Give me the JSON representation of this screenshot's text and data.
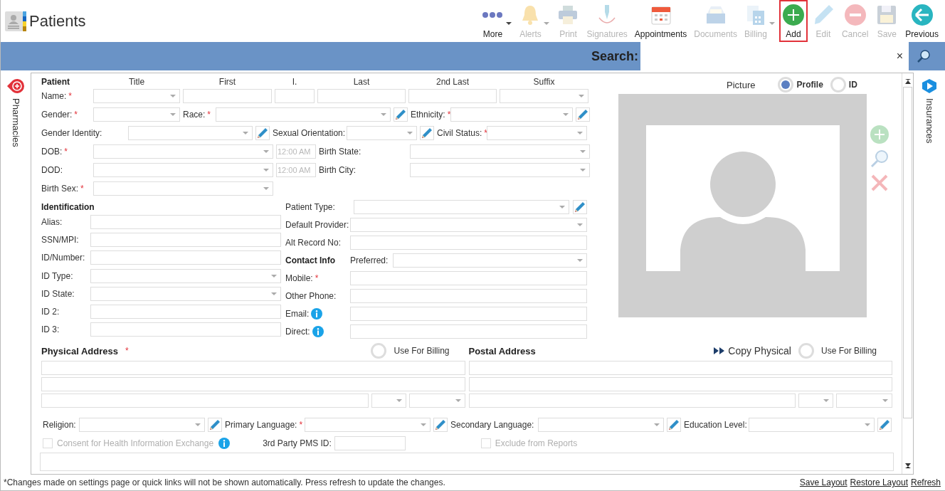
{
  "header": {
    "title": "Patients"
  },
  "toolbar": [
    {
      "label": "More",
      "kind": "more",
      "disabled": false,
      "dropdown": true,
      "highlighted": false
    },
    {
      "label": "Alerts",
      "kind": "alerts",
      "disabled": true,
      "dropdown": true,
      "highlighted": false
    },
    {
      "label": "Print",
      "kind": "print",
      "disabled": true,
      "dropdown": false,
      "highlighted": false
    },
    {
      "label": "Signatures",
      "kind": "signatures",
      "disabled": true,
      "dropdown": false,
      "highlighted": false
    },
    {
      "label": "Appointments",
      "kind": "appointments",
      "disabled": false,
      "dropdown": false,
      "highlighted": false
    },
    {
      "label": "Documents",
      "kind": "documents",
      "disabled": true,
      "dropdown": false,
      "highlighted": false
    },
    {
      "label": "Billing",
      "kind": "billing",
      "disabled": true,
      "dropdown": true,
      "highlighted": false
    },
    {
      "label": "Add",
      "kind": "add",
      "disabled": false,
      "dropdown": false,
      "highlighted": true
    },
    {
      "label": "Edit",
      "kind": "edit",
      "disabled": true,
      "dropdown": false,
      "highlighted": false
    },
    {
      "label": "Cancel",
      "kind": "cancel",
      "disabled": true,
      "dropdown": false,
      "highlighted": false
    },
    {
      "label": "Save",
      "kind": "save",
      "disabled": true,
      "dropdown": false,
      "highlighted": false
    },
    {
      "label": "Previous",
      "kind": "previous",
      "disabled": false,
      "dropdown": false,
      "highlighted": false
    }
  ],
  "search": {
    "label": "Search:",
    "clear": "×"
  },
  "left_rail": {
    "label": "Pharmacies"
  },
  "right_rail": {
    "label": "Insurances"
  },
  "patient": {
    "heading": "Patient",
    "columns": [
      "Title",
      "First",
      "I.",
      "Last",
      "2nd Last",
      "Suffix"
    ],
    "name": {
      "label": "Name:",
      "required_mark": "*",
      "fields": [
        {
          "kind": "dropdown"
        },
        {
          "kind": "text"
        },
        {
          "kind": "text"
        },
        {
          "kind": "text"
        },
        {
          "kind": "text"
        },
        {
          "kind": "dropdown"
        }
      ]
    }
  },
  "demographics": [
    [
      {
        "label": "Gender:",
        "required_mark": "*",
        "kind": "dropdown",
        "edit": false
      },
      {
        "label": "Race:",
        "required_mark": "*",
        "kind": "dropdown",
        "edit": true
      },
      {
        "label": "Ethnicity:",
        "required_mark": "*",
        "kind": "dropdown",
        "edit": true
      }
    ],
    [
      {
        "label": "Gender Identity:",
        "kind": "dropdown",
        "edit": true
      },
      {
        "label": "Sexual Orientation:",
        "kind": "dropdown",
        "edit": true
      },
      {
        "label": "Civil Status:",
        "required_mark": "*",
        "kind": "dropdown",
        "edit": false
      }
    ],
    [
      {
        "label": "DOB:",
        "required_mark": "*",
        "kind": "dropdown",
        "edit": false
      },
      {
        "kind": "time",
        "value": "12:00 AM",
        "disabled": true
      },
      {
        "label": "Birth State:",
        "kind": "dropdown",
        "edit": false
      }
    ],
    [
      {
        "label": "DOD:",
        "kind": "dropdown",
        "edit": false
      },
      {
        "kind": "time",
        "value": "12:00 AM",
        "disabled": true
      },
      {
        "label": "Birth City:",
        "kind": "dropdown",
        "edit": false
      }
    ],
    [
      {
        "label": "Birth Sex:",
        "required_mark": "*",
        "kind": "dropdown",
        "edit": false
      }
    ]
  ],
  "identification": {
    "heading": "Identification",
    "fields": [
      {
        "label": "Alias:",
        "kind": "text"
      },
      {
        "label": "SSN/MPI:",
        "kind": "text"
      },
      {
        "label": "ID/Number:",
        "kind": "text"
      },
      {
        "label": "ID Type:",
        "kind": "dropdown"
      },
      {
        "label": "ID State:",
        "kind": "dropdown"
      },
      {
        "label": "ID 2:",
        "kind": "text"
      },
      {
        "label": "ID 3:",
        "kind": "text"
      }
    ]
  },
  "details": [
    {
      "label": "Patient Type:",
      "kind": "dropdown",
      "edit": true
    },
    {
      "label": "Default Provider:",
      "kind": "dropdown",
      "edit": false
    },
    {
      "label": "Alt Record No:",
      "kind": "text",
      "edit": false
    }
  ],
  "contact": {
    "heading": "Contact Info",
    "preferred": {
      "label": "Preferred:",
      "kind": "dropdown"
    },
    "fields": [
      {
        "label": "Mobile:",
        "required_mark": "*",
        "kind": "text",
        "info": false
      },
      {
        "label": "Other Phone:",
        "kind": "text",
        "info": false
      },
      {
        "label": "Email:",
        "kind": "text",
        "info": true
      },
      {
        "label": "Direct:",
        "kind": "text",
        "info": true
      }
    ]
  },
  "picture": {
    "title": "Picture",
    "options": [
      {
        "label": "Profile",
        "selected": true
      },
      {
        "label": "ID",
        "selected": false
      }
    ],
    "actions": [
      {
        "kind": "add",
        "disabled": true
      },
      {
        "kind": "zoom",
        "disabled": true
      },
      {
        "kind": "delete",
        "disabled": true
      }
    ]
  },
  "physical_address": {
    "heading": "Physical Address",
    "required_mark": "*",
    "use_for_billing": {
      "label": "Use For Billing",
      "selected": false
    },
    "lines": [
      [
        {
          "kind": "text"
        }
      ],
      [
        {
          "kind": "text"
        }
      ],
      [
        {
          "kind": "text"
        },
        {
          "kind": "dropdown"
        },
        {
          "kind": "dropdown"
        }
      ]
    ]
  },
  "postal_address": {
    "heading": "Postal Address",
    "copy_label": "Copy Physical",
    "use_for_billing": {
      "label": "Use For Billing",
      "selected": false
    },
    "lines": [
      [
        {
          "kind": "text"
        }
      ],
      [
        {
          "kind": "text"
        }
      ],
      [
        {
          "kind": "text"
        },
        {
          "kind": "dropdown"
        },
        {
          "kind": "dropdown"
        }
      ]
    ]
  },
  "profile_fields": [
    {
      "label": "Religion:",
      "kind": "dropdown",
      "edit": true
    },
    {
      "label": "Primary Language:",
      "required_mark": "*",
      "kind": "dropdown",
      "edit": true
    },
    {
      "label": "Secondary Language:",
      "kind": "dropdown",
      "edit": true
    },
    {
      "label": "Education Level:",
      "kind": "dropdown",
      "edit": true
    }
  ],
  "options_row": [
    {
      "kind": "checkbox",
      "label": "Consent for Health Information Exchange",
      "checked": false,
      "disabled": true,
      "info": true
    },
    {
      "kind": "field",
      "label": "3rd Party PMS ID:"
    },
    {
      "kind": "checkbox",
      "label": "Exclude from Reports",
      "checked": false,
      "disabled": true,
      "info": false
    }
  ],
  "footer": {
    "note": "*Changes made on settings page or quick links will not be shown automatically. Press refresh to update the changes.",
    "links": [
      "Save Layout",
      "Restore Layout",
      "Refresh"
    ]
  }
}
